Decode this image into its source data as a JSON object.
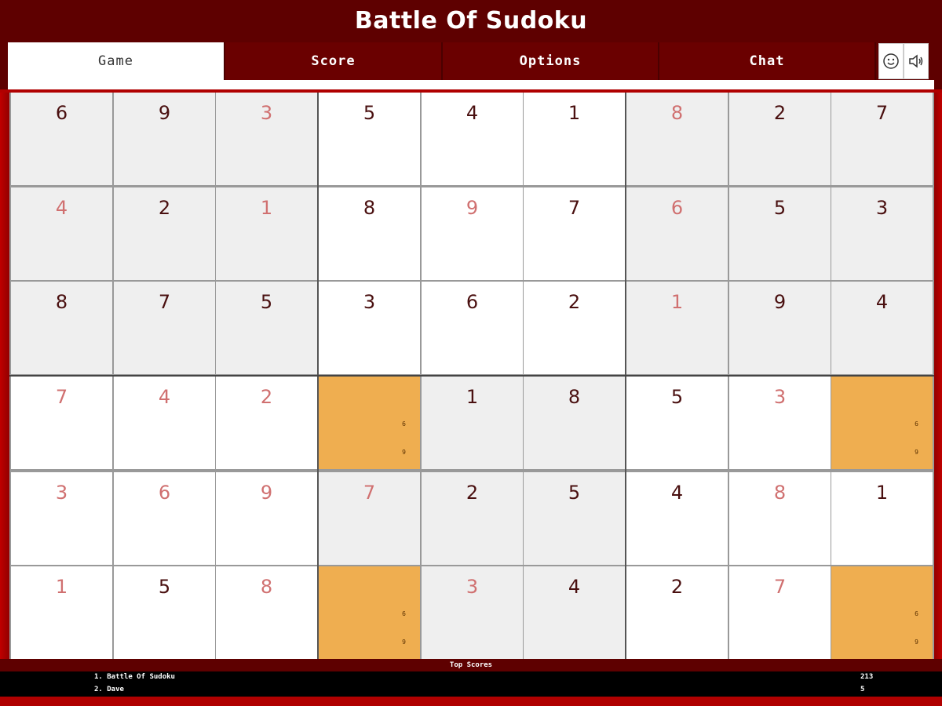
{
  "app": {
    "title": "Battle Of Sudoku"
  },
  "tabs": [
    {
      "label": "Game",
      "active": true
    },
    {
      "label": "Score",
      "active": false
    },
    {
      "label": "Options",
      "active": false
    },
    {
      "label": "Chat",
      "active": false
    }
  ],
  "toolbar_icons": [
    "smiley-icon",
    "speaker-icon"
  ],
  "colors": {
    "header_bg": "#5e0000",
    "accent_red": "#b00000",
    "highlight_cell": "#efae50",
    "given_digit": "#4a1010",
    "entered_digit": "#d07070"
  },
  "board": {
    "rows": [
      [
        {
          "v": "6",
          "k": "given",
          "bg": "gray"
        },
        {
          "v": "9",
          "k": "given",
          "bg": "gray"
        },
        {
          "v": "3",
          "k": "entered",
          "bg": "gray"
        },
        {
          "v": "5",
          "k": "given",
          "bg": "white"
        },
        {
          "v": "4",
          "k": "given",
          "bg": "white"
        },
        {
          "v": "1",
          "k": "given",
          "bg": "white"
        },
        {
          "v": "8",
          "k": "entered",
          "bg": "gray"
        },
        {
          "v": "2",
          "k": "given",
          "bg": "gray"
        },
        {
          "v": "7",
          "k": "given",
          "bg": "gray"
        }
      ],
      [
        {
          "v": "4",
          "k": "entered",
          "bg": "gray"
        },
        {
          "v": "2",
          "k": "given",
          "bg": "gray"
        },
        {
          "v": "1",
          "k": "entered",
          "bg": "gray"
        },
        {
          "v": "8",
          "k": "given",
          "bg": "white"
        },
        {
          "v": "9",
          "k": "entered",
          "bg": "white"
        },
        {
          "v": "7",
          "k": "given",
          "bg": "white"
        },
        {
          "v": "6",
          "k": "entered",
          "bg": "gray"
        },
        {
          "v": "5",
          "k": "given",
          "bg": "gray"
        },
        {
          "v": "3",
          "k": "given",
          "bg": "gray"
        }
      ],
      [
        {
          "v": "8",
          "k": "given",
          "bg": "gray"
        },
        {
          "v": "7",
          "k": "given",
          "bg": "gray"
        },
        {
          "v": "5",
          "k": "given",
          "bg": "gray"
        },
        {
          "v": "3",
          "k": "given",
          "bg": "white"
        },
        {
          "v": "6",
          "k": "given",
          "bg": "white"
        },
        {
          "v": "2",
          "k": "given",
          "bg": "white"
        },
        {
          "v": "1",
          "k": "entered",
          "bg": "gray"
        },
        {
          "v": "9",
          "k": "given",
          "bg": "gray"
        },
        {
          "v": "4",
          "k": "given",
          "bg": "gray"
        }
      ],
      [
        {
          "v": "7",
          "k": "entered",
          "bg": "white"
        },
        {
          "v": "4",
          "k": "entered",
          "bg": "white"
        },
        {
          "v": "2",
          "k": "entered",
          "bg": "white"
        },
        {
          "v": "",
          "k": "given",
          "bg": "orange",
          "cands": [
            "6",
            "9"
          ]
        },
        {
          "v": "1",
          "k": "given",
          "bg": "gray"
        },
        {
          "v": "8",
          "k": "given",
          "bg": "gray"
        },
        {
          "v": "5",
          "k": "given",
          "bg": "white"
        },
        {
          "v": "3",
          "k": "entered",
          "bg": "white"
        },
        {
          "v": "",
          "k": "given",
          "bg": "orange",
          "cands": [
            "6",
            "9"
          ]
        }
      ],
      [
        {
          "v": "3",
          "k": "entered",
          "bg": "white"
        },
        {
          "v": "6",
          "k": "entered",
          "bg": "white"
        },
        {
          "v": "9",
          "k": "entered",
          "bg": "white"
        },
        {
          "v": "7",
          "k": "entered",
          "bg": "gray"
        },
        {
          "v": "2",
          "k": "given",
          "bg": "gray"
        },
        {
          "v": "5",
          "k": "given",
          "bg": "gray"
        },
        {
          "v": "4",
          "k": "given",
          "bg": "white"
        },
        {
          "v": "8",
          "k": "entered",
          "bg": "white"
        },
        {
          "v": "1",
          "k": "given",
          "bg": "white"
        }
      ],
      [
        {
          "v": "1",
          "k": "entered",
          "bg": "white"
        },
        {
          "v": "5",
          "k": "given",
          "bg": "white"
        },
        {
          "v": "8",
          "k": "entered",
          "bg": "white"
        },
        {
          "v": "",
          "k": "given",
          "bg": "orange",
          "cands": [
            "6",
            "9"
          ]
        },
        {
          "v": "3",
          "k": "entered",
          "bg": "gray"
        },
        {
          "v": "4",
          "k": "given",
          "bg": "gray"
        },
        {
          "v": "2",
          "k": "given",
          "bg": "white"
        },
        {
          "v": "7",
          "k": "entered",
          "bg": "white"
        },
        {
          "v": "",
          "k": "given",
          "bg": "orange",
          "cands": [
            "6",
            "9"
          ]
        }
      ]
    ]
  },
  "top_scores": {
    "title": "Top Scores",
    "entries": [
      {
        "name": "1. Battle Of Sudoku",
        "score": "213"
      },
      {
        "name": "2. Dave",
        "score": "5"
      }
    ]
  }
}
